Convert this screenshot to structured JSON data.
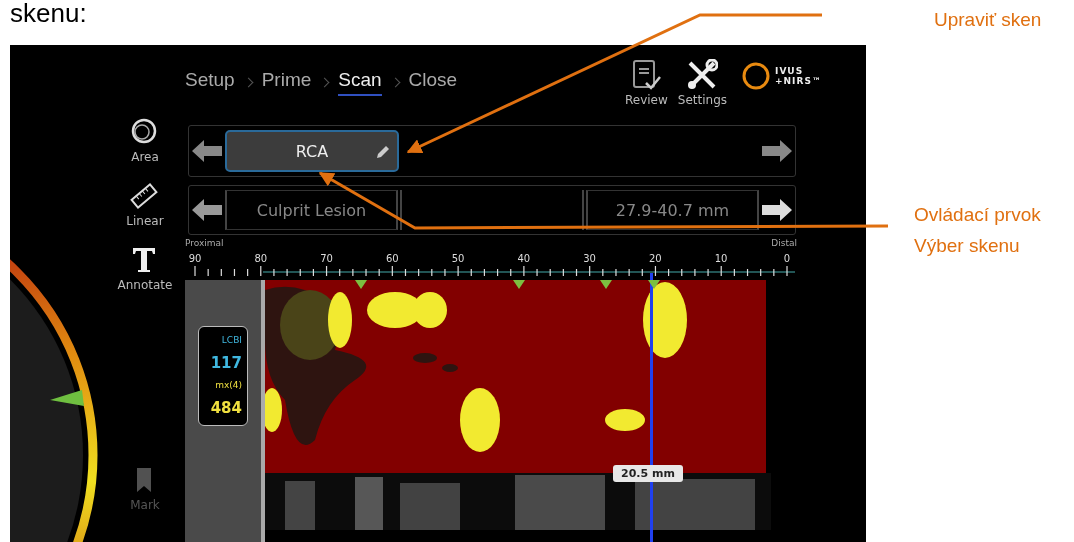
{
  "intro_text": "skenu:",
  "breadcrumb": [
    {
      "label": "Setup",
      "selected": false
    },
    {
      "label": "Prime",
      "selected": false
    },
    {
      "label": "Scan",
      "selected": true
    },
    {
      "label": "Close",
      "selected": false
    }
  ],
  "tools": [
    {
      "label": "Area",
      "kind": "area",
      "disabled": false
    },
    {
      "label": "Linear",
      "kind": "linear",
      "disabled": false
    },
    {
      "label": "Annotate",
      "kind": "annotate",
      "disabled": false
    },
    {
      "label": "Mark",
      "kind": "mark",
      "disabled": true
    }
  ],
  "header_buttons": [
    {
      "label": "Review",
      "kind": "review"
    },
    {
      "label": "Settings",
      "kind": "settings"
    }
  ],
  "logo": {
    "line_1": "IVUS",
    "line_2": "+NIRS™"
  },
  "scan_selector": {
    "scan_name": "RCA"
  },
  "segment_selector": {
    "segments": [
      "Culprit Lesion",
      "27.9-40.7 mm"
    ]
  },
  "axis": {
    "proximal": "Proximal",
    "distal": "Distal",
    "ticks": [
      "90",
      "80",
      "70",
      "60",
      "50",
      "40",
      "30",
      "20",
      "10",
      "0"
    ]
  },
  "lcbi": {
    "label": "LCBI",
    "value": "117",
    "max_label": "mx(4)",
    "max_value": "484"
  },
  "cursor": {
    "reading": "20.5 mm"
  },
  "callouts": [
    {
      "text": "Upraviť sken"
    },
    {
      "text": "Ovládací prvok Výber skenu"
    }
  ]
}
